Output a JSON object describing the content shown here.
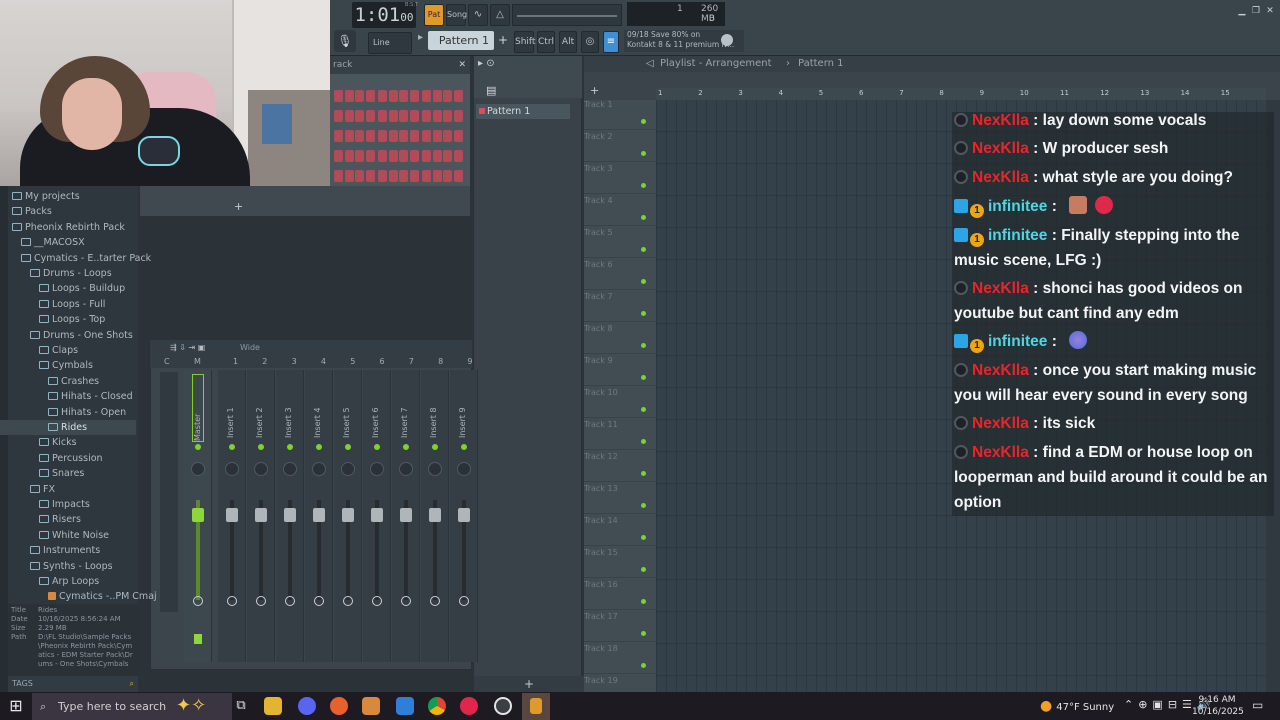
{
  "fl": {
    "time": "1:01",
    "time_ticks": "00",
    "time_caption": "B:S:T",
    "tool_buttons": [
      "Pat",
      "Song",
      "Line"
    ],
    "pattern": "Pattern 1",
    "mod_keys": [
      "Shift",
      "Ctrl",
      "Alt"
    ],
    "cpu_value": "1",
    "memory": "260 MB",
    "polyphony": "0",
    "hint_line1": "09/18  Save 80% on",
    "hint_line2": "Kontakt 8 & 11 premium N..."
  },
  "channel_rack": {
    "title": "rack"
  },
  "browser": {
    "items": [
      {
        "label": "My projects",
        "indent": 0
      },
      {
        "label": "Packs",
        "indent": 0
      },
      {
        "label": "Pheonix Rebirth Pack",
        "indent": 0
      },
      {
        "label": "__MACOSX",
        "indent": 1
      },
      {
        "label": "Cymatics - E..tarter Pack",
        "indent": 1
      },
      {
        "label": "Drums - Loops",
        "indent": 2
      },
      {
        "label": "Loops - Buildup",
        "indent": 3
      },
      {
        "label": "Loops - Full",
        "indent": 3
      },
      {
        "label": "Loops - Top",
        "indent": 3
      },
      {
        "label": "Drums - One Shots",
        "indent": 2
      },
      {
        "label": "Claps",
        "indent": 3
      },
      {
        "label": "Cymbals",
        "indent": 3
      },
      {
        "label": "Crashes",
        "indent": 4
      },
      {
        "label": "Hihats - Closed",
        "indent": 4
      },
      {
        "label": "Hihats - Open",
        "indent": 4
      },
      {
        "label": "Rides",
        "indent": 4
      },
      {
        "label": "Kicks",
        "indent": 3
      },
      {
        "label": "Percussion",
        "indent": 3
      },
      {
        "label": "Snares",
        "indent": 3
      },
      {
        "label": "FX",
        "indent": 2
      },
      {
        "label": "Impacts",
        "indent": 3
      },
      {
        "label": "Risers",
        "indent": 3
      },
      {
        "label": "White Noise",
        "indent": 3
      },
      {
        "label": "Instruments",
        "indent": 2
      },
      {
        "label": "Synths - Loops",
        "indent": 2
      },
      {
        "label": "Arp Loops",
        "indent": 3
      },
      {
        "label": "Cymatics -..PM Cmaj",
        "indent": 4
      }
    ],
    "info": {
      "title_label": "Title",
      "title": "Rides",
      "date_label": "Date",
      "date": "10/16/2025 8:56:24 AM",
      "size_label": "Size",
      "size": "2.29 MB",
      "path_label": "Path",
      "path": "D:\\FL Studio\\Sample Packs\\Pheonix Rebirth Pack\\Cymatics - EDM Starter Pack\\Drums - One Shots\\Cymbals\\Rides"
    },
    "tags_label": "TAGS"
  },
  "mixer": {
    "preset": "Wide",
    "numbers": [
      "C",
      "M",
      "1",
      "2",
      "3",
      "4",
      "5",
      "6",
      "7",
      "8",
      "9"
    ],
    "strips": [
      "Master",
      "Insert 1",
      "Insert 2",
      "Insert 3",
      "Insert 4",
      "Insert 5",
      "Insert 6",
      "Insert 7",
      "Insert 8",
      "Insert 9"
    ]
  },
  "picker": {
    "item": "Pattern 1"
  },
  "playlist": {
    "title": "Playlist - Arrangement",
    "sep": "›",
    "pattern": "Pattern 1",
    "ruler": [
      "1",
      "2",
      "3",
      "4",
      "5",
      "6",
      "7",
      "8",
      "9",
      "10",
      "11",
      "12",
      "13",
      "14",
      "15"
    ],
    "tracks": [
      "Track 1",
      "Track 2",
      "Track 3",
      "Track 4",
      "Track 5",
      "Track 6",
      "Track 7",
      "Track 8",
      "Track 9",
      "Track 10",
      "Track 11",
      "Track 12",
      "Track 13",
      "Track 14",
      "Track 15",
      "Track 16",
      "Track 17",
      "Track 18",
      "Track 19"
    ],
    "add_symbol": "+"
  },
  "chat": [
    {
      "user": "NexKlla",
      "text": "lay down some vocals",
      "badges": [
        "mod"
      ]
    },
    {
      "user": "NexKlla",
      "text": "W producer sesh",
      "badges": [
        "mod"
      ]
    },
    {
      "user": "NexKlla",
      "text": "what style are you doing?",
      "badges": [
        "mod"
      ]
    },
    {
      "user": "infinitee",
      "text": "",
      "badges": [
        "prime",
        "sub"
      ],
      "emotes": [
        "face-emote",
        "burst-emote"
      ]
    },
    {
      "user": "infinitee",
      "text": "Finally stepping into the music scene, LFG :)",
      "badges": [
        "prime",
        "sub"
      ]
    },
    {
      "user": "NexKlla",
      "text": "shonci has good videos on youtube but cant find any edm",
      "badges": [
        "mod"
      ]
    },
    {
      "user": "infinitee",
      "text": "",
      "badges": [
        "prime",
        "sub"
      ],
      "emotes": [
        "disco-emote"
      ]
    },
    {
      "user": "NexKlla",
      "text": "once you start making music you will hear every sound in every song",
      "badges": [
        "mod"
      ]
    },
    {
      "user": "NexKlla",
      "text": "its sick",
      "badges": [
        "mod"
      ]
    },
    {
      "user": "NexKlla",
      "text": "find a EDM or house loop on looperman and build around it could be an option",
      "badges": [
        "mod"
      ]
    }
  ],
  "taskbar": {
    "search_placeholder": "Type here to search",
    "weather": "47°F  Sunny",
    "time": "9:16 AM",
    "date": "10/16/2025"
  },
  "colors": {
    "chat_user_red": "#e8262a",
    "chat_user_cyan": "#4fd6e0",
    "step_on": "#b24b57",
    "led_green": "#7fd12d"
  }
}
